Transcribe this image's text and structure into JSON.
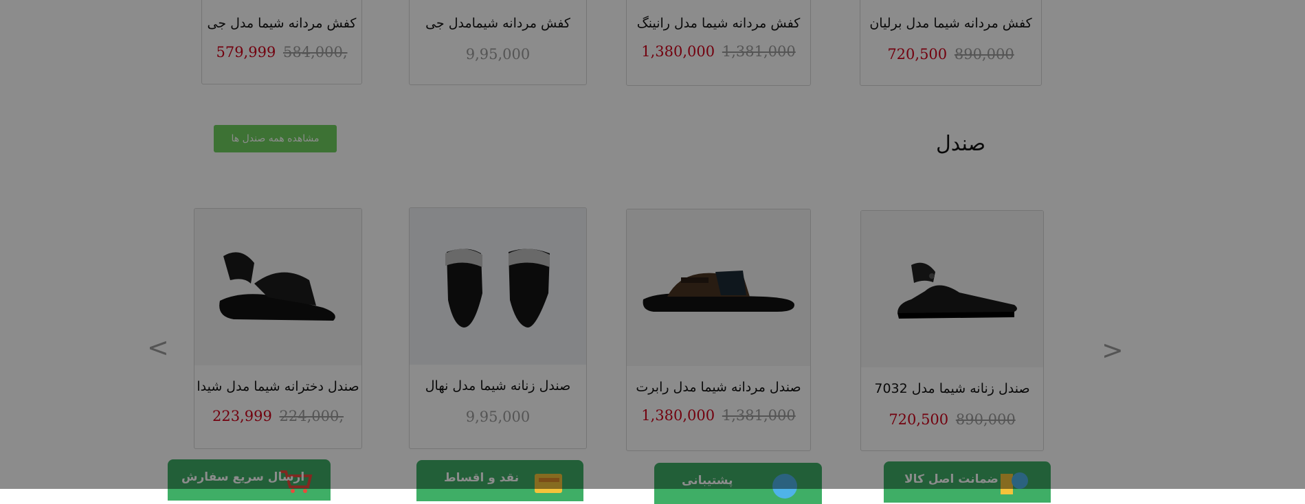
{
  "shoes_row": [
    {
      "name": "کفش مردانه شیما مدل برلیان",
      "price_new": "720,500",
      "price_old": "890,000"
    },
    {
      "name": "کفش مردانه شیما مدل رانینگ",
      "price_new": "1,380,000",
      "price_old": "1,381,000"
    },
    {
      "name": "کفش مردانه شیمامدل جی",
      "price_only": "9,95,000"
    },
    {
      "name": "کفش مردانه شیما مدل جی",
      "price_new": "579,999",
      "price_old": "584,000,"
    }
  ],
  "sandal_section": {
    "title": "صندل",
    "view_all_label": "مشاهده همه صندل ها",
    "prev_arrow": "<",
    "next_arrow": ">"
  },
  "sandals_row": [
    {
      "name": "صندل زنانه شیما مدل 7032",
      "price_new": "720,500",
      "price_old": "890,000",
      "image": "black-ankle-strap-sandal"
    },
    {
      "name": "صندل مردانه شیما مدل رابرت",
      "price_new": "1,380,000",
      "price_old": "1,381,000",
      "image": "brown-mens-sandal"
    },
    {
      "name": "صندل زنانه شیما مدل نهال",
      "price_only": "9,95,000",
      "image": "black-pointed-mules"
    },
    {
      "name": "صندل دخترانه شیما مدل شیدا",
      "price_new": "223,999",
      "price_old": "224,000,",
      "image": "black-girls-sandal"
    }
  ],
  "features": [
    {
      "label": "ضمانت اصل کالا",
      "icon": "badge-icon"
    },
    {
      "label": "پشتیبانی",
      "icon": "support-icon"
    },
    {
      "label": "نقد و اقساط",
      "icon": "wallet-icon"
    },
    {
      "label": "ارسال سریع سفارش",
      "icon": "cart-icon"
    }
  ],
  "colors": {
    "price_red": "#d0021b",
    "button_green": "#6fcf5f",
    "feature_green": "#3fae66"
  }
}
